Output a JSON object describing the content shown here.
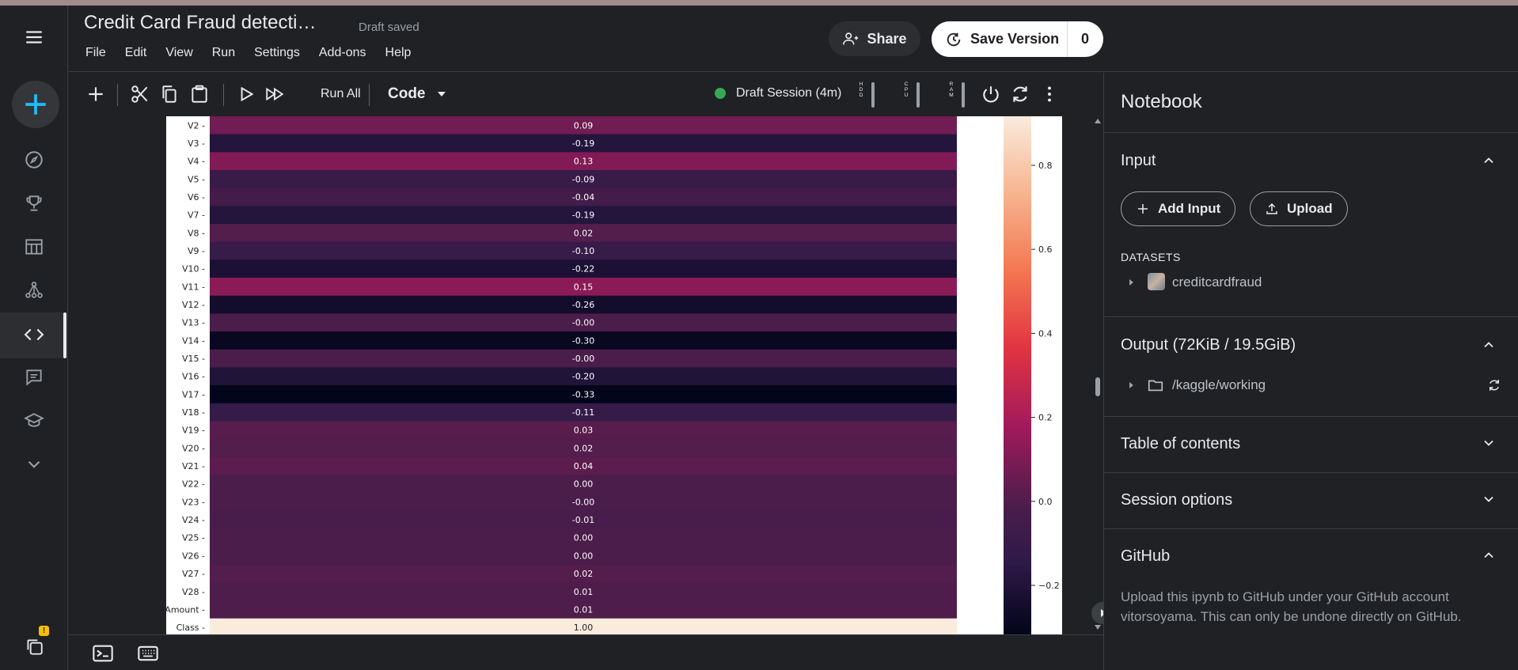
{
  "header": {
    "title": "Credit Card Fraud detecti…",
    "status": "Draft saved",
    "menu": [
      "File",
      "Edit",
      "View",
      "Run",
      "Settings",
      "Add-ons",
      "Help"
    ],
    "share_label": "Share",
    "save_version_label": "Save Version",
    "version_count": "0"
  },
  "toolbar": {
    "run_all_label": "Run All",
    "cell_type": "Code",
    "session_status": "Draft Session (4m)",
    "meters": [
      {
        "label": "H D D",
        "name": "hdd"
      },
      {
        "label": "C P U",
        "name": "cpu"
      },
      {
        "label": "R A M",
        "name": "ram"
      }
    ]
  },
  "panel": {
    "title": "Notebook",
    "input": {
      "heading": "Input",
      "add_input_label": "Add Input",
      "upload_label": "Upload",
      "datasets_label": "DATASETS",
      "dataset_name": "creditcardfraud"
    },
    "output": {
      "heading": "Output (72KiB / 19.5GiB)",
      "path": "/kaggle/working"
    },
    "toc": {
      "heading": "Table of contents"
    },
    "session": {
      "heading": "Session options"
    },
    "github": {
      "heading": "GitHub",
      "description": "Upload this ipynb to GitHub under your GitHub account vitorsoyama. This can only be undone directly on GitHub."
    }
  },
  "chart_data": {
    "type": "heatmap",
    "rows": [
      "V2",
      "V3",
      "V4",
      "V5",
      "V6",
      "V7",
      "V8",
      "V9",
      "V10",
      "V11",
      "V12",
      "V13",
      "V14",
      "V15",
      "V16",
      "V17",
      "V18",
      "V19",
      "V20",
      "V21",
      "V22",
      "V23",
      "V24",
      "V25",
      "V26",
      "V27",
      "V28",
      "Amount",
      "Class"
    ],
    "values": [
      0.09,
      -0.19,
      0.13,
      -0.09,
      -0.04,
      -0.19,
      0.02,
      -0.1,
      -0.22,
      0.15,
      -0.26,
      -0.0,
      -0.3,
      -0.0,
      -0.2,
      -0.33,
      -0.11,
      0.03,
      0.02,
      0.04,
      0.0,
      -0.0,
      -0.01,
      0.0,
      0.0,
      0.02,
      0.01,
      0.01,
      1.0
    ],
    "labels": [
      "0.09",
      "-0.19",
      "0.13",
      "-0.09",
      "-0.04",
      "-0.19",
      "0.02",
      "-0.10",
      "-0.22",
      "0.15",
      "-0.26",
      "-0.00",
      "-0.30",
      "-0.00",
      "-0.20",
      "-0.33",
      "-0.11",
      "0.03",
      "0.02",
      "0.04",
      "0.00",
      "-0.00",
      "-0.01",
      "0.00",
      "0.00",
      "0.02",
      "0.01",
      "0.01",
      "1.00"
    ],
    "colorbar_ticks": [
      "0.8",
      "0.6",
      "0.4",
      "0.2",
      "0.0",
      "−0.2"
    ],
    "colorbar_tick_values": [
      0.8,
      0.6,
      0.4,
      0.2,
      0.0,
      -0.2
    ],
    "colorbar_range": [
      -0.33,
      1.0
    ]
  }
}
